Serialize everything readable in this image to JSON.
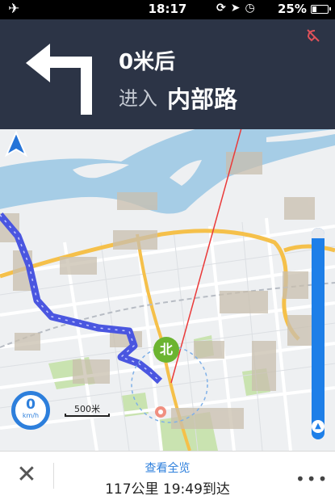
{
  "status_bar": {
    "time": "18:17",
    "battery_percent": "25%",
    "battery_level": 0.25,
    "icons": [
      "airplane-mode-icon",
      "rotation-lock-icon",
      "location-icon",
      "alarm-icon",
      "battery-icon"
    ]
  },
  "nav": {
    "distance": "0米后",
    "action": "进入",
    "road": "内部路",
    "turn_icon": "turn-left-icon",
    "sound_icon": "sound-off-icon"
  },
  "map": {
    "north_label": "北",
    "speed_value": "0",
    "speed_unit": "km/h",
    "scale_label": "500米",
    "route_progress": 0.05,
    "colors": {
      "route": "#4a56e0",
      "river": "#a6cde6",
      "park": "#c9e3b0",
      "highway": "#f5c04a",
      "progress": "#1e7fe8",
      "header": "#2c3446"
    }
  },
  "bottom": {
    "overview_label": "查看全览",
    "eta": "117公里 19:49到达",
    "close_icon": "close-icon",
    "more_icon": "more-icon"
  }
}
